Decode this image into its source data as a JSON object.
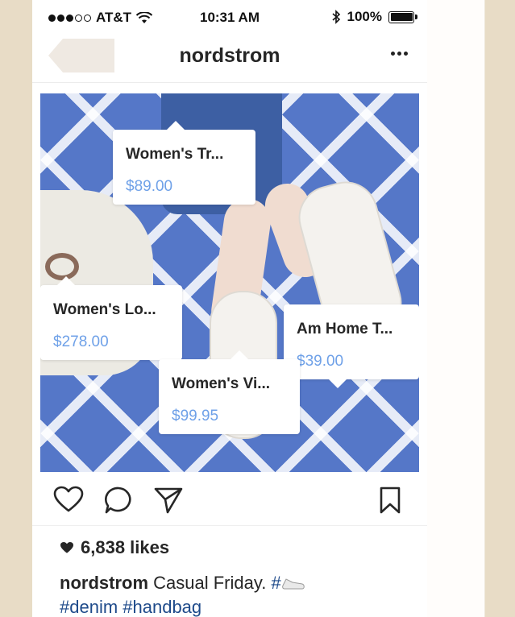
{
  "status_bar": {
    "carrier": "AT&T",
    "time": "10:31 AM",
    "battery": "100%",
    "signal_icon": "signal-dots-icon",
    "wifi_icon": "wifi-icon",
    "bluetooth_icon": "bluetooth-icon",
    "battery_icon": "battery-icon"
  },
  "nav": {
    "title": "nordstrom",
    "back_icon": "back-icon",
    "more_icon": "more-icon"
  },
  "post": {
    "tags": [
      {
        "name": "Women's Tr...",
        "price": "$89.00"
      },
      {
        "name": "Women's Lo...",
        "price": "$278.00"
      },
      {
        "name": "Am Home T...",
        "price": "$39.00"
      },
      {
        "name": "Women's Vi...",
        "price": "$99.95"
      }
    ],
    "likes": "6,838 likes",
    "caption": {
      "username": "nordstrom",
      "text": "Casual Friday.",
      "hash_prefix": "#",
      "hashtags": "#denim #handbag"
    }
  },
  "colors": {
    "accent_price": "#6fa1e8",
    "hashtag": "#1e4a8a",
    "rug_blue": "#5577c8",
    "background": "#e8dcc6"
  }
}
